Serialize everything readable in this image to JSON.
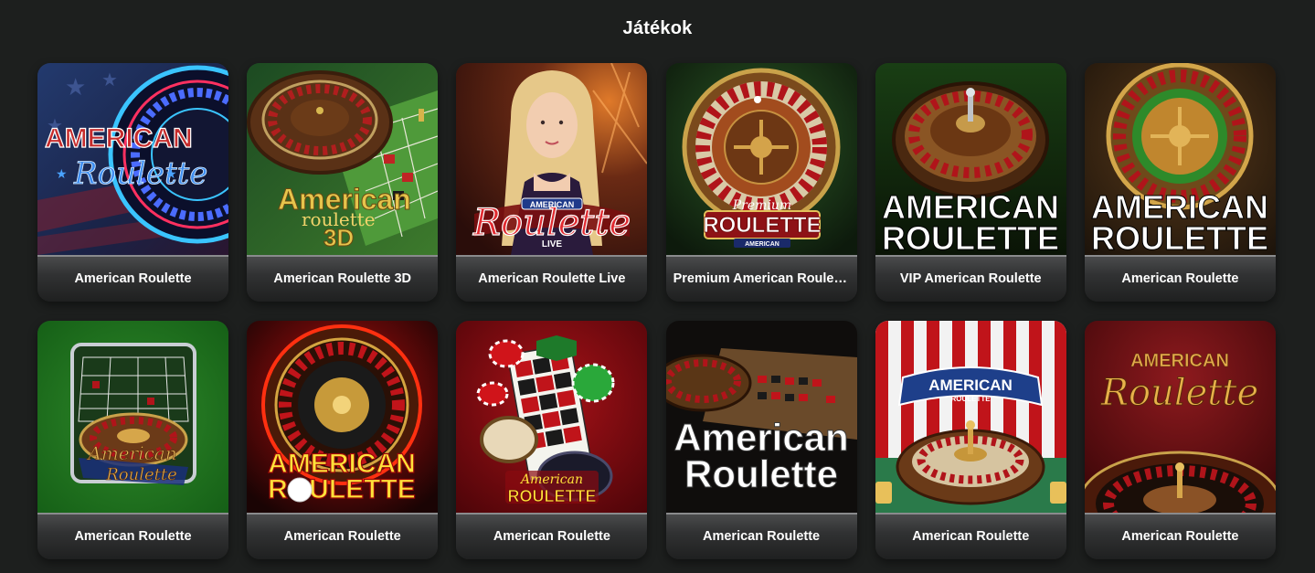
{
  "section": {
    "title": "Játékok"
  },
  "games": [
    {
      "label": "American Roulette",
      "art_line1": "AMERICAN",
      "art_line2": "Roulette"
    },
    {
      "label": "American Roulette 3D",
      "art_line1": "American",
      "art_line2": "roulette",
      "art_line3": "3D"
    },
    {
      "label": "American Roulette Live",
      "art_line1": "AMERICAN",
      "art_line2": "Roulette",
      "art_line3": "LIVE"
    },
    {
      "label": "Premium American Roulette",
      "art_line1": "Premium",
      "art_line2": "ROULETTE",
      "art_line3": "AMERICAN"
    },
    {
      "label": "VIP American Roulette",
      "art_line1": "AMERICAN",
      "art_line2": "ROULETTE"
    },
    {
      "label": "American Roulette",
      "art_line1": "AMERICAN",
      "art_line2": "ROULETTE"
    },
    {
      "label": "American Roulette",
      "art_line1": "American",
      "art_line2": "Roulette"
    },
    {
      "label": "American Roulette",
      "art_line1": "AMERICAN",
      "art_line2": "ROULETTE"
    },
    {
      "label": "American Roulette",
      "art_line1": "American",
      "art_line2": "ROULETTE"
    },
    {
      "label": "American Roulette",
      "art_line1": "American",
      "art_line2": "Roulette"
    },
    {
      "label": "American Roulette",
      "art_line1": "AMERICAN",
      "art_line2": "ROULETTE"
    },
    {
      "label": "American Roulette",
      "art_line1": "AMERICAN",
      "art_line2": "Roulette"
    }
  ],
  "colors": {
    "background": "#1d1f1e",
    "label_text": "#ffffff",
    "label_bar_top": "#4a4b4c",
    "label_bar_bottom": "#1f2020"
  }
}
